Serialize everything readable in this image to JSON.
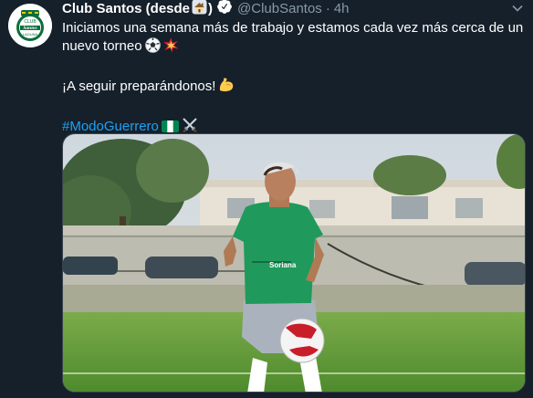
{
  "tweet": {
    "author_name": "Club Santos (desde",
    "author_name_close": ")",
    "handle": "@ClubSantos",
    "separator": "·",
    "time": "4h",
    "text_line_1": "Iniciamos una semana más de trabajo y estamos cada vez más cerca de un nuevo torneo",
    "text_line_2": "¡A seguir preparándonos!",
    "hashtag": "#ModoGuerrero",
    "avatar_text_top": "CLUB",
    "avatar_text_main": "Santos",
    "avatar_text_bottom": "LAGUNA"
  },
  "icons": {
    "house": "house-emoji",
    "verified": "verified-icon",
    "soccer": "soccer-ball-emoji",
    "collision": "collision-emoji",
    "muscle": "flexed-biceps-emoji",
    "flag": "nigeria-flag-emoji",
    "swords": "crossed-swords-emoji",
    "menu": "chevron-down-icon"
  },
  "colors": {
    "background": "#15202b",
    "text": "#ffffff",
    "muted": "#8899a6",
    "link": "#1da1f2",
    "santos_green": "#0b6e3b"
  },
  "media": {
    "description_icons": [
      "player",
      "soccer-ball",
      "grass-field",
      "trees",
      "buildings",
      "parked-cars",
      "fence"
    ],
    "shirt_text": "Soriana"
  }
}
